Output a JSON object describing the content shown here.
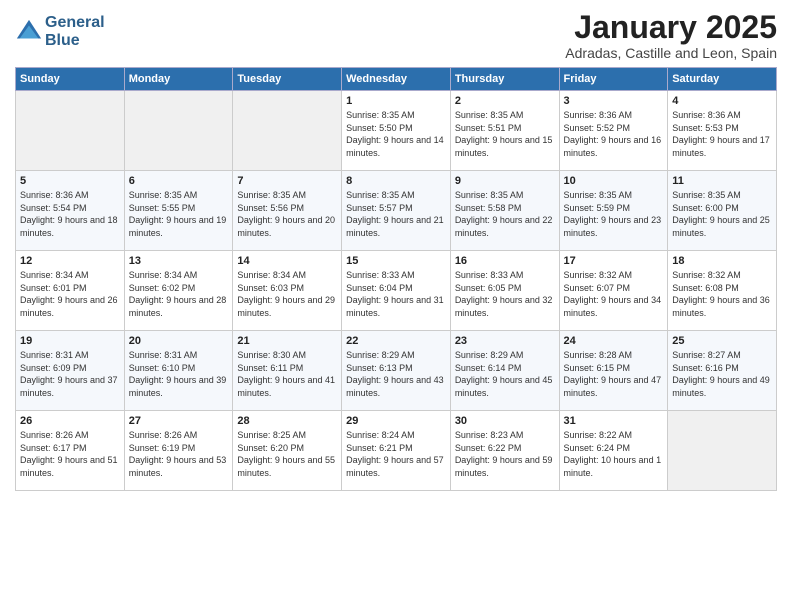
{
  "header": {
    "logo_line1": "General",
    "logo_line2": "Blue",
    "month_title": "January 2025",
    "location": "Adradas, Castille and Leon, Spain"
  },
  "weekdays": [
    "Sunday",
    "Monday",
    "Tuesday",
    "Wednesday",
    "Thursday",
    "Friday",
    "Saturday"
  ],
  "weeks": [
    [
      {
        "day": "",
        "sunrise": "",
        "sunset": "",
        "daylight": ""
      },
      {
        "day": "",
        "sunrise": "",
        "sunset": "",
        "daylight": ""
      },
      {
        "day": "",
        "sunrise": "",
        "sunset": "",
        "daylight": ""
      },
      {
        "day": "1",
        "sunrise": "Sunrise: 8:35 AM",
        "sunset": "Sunset: 5:50 PM",
        "daylight": "Daylight: 9 hours and 14 minutes."
      },
      {
        "day": "2",
        "sunrise": "Sunrise: 8:35 AM",
        "sunset": "Sunset: 5:51 PM",
        "daylight": "Daylight: 9 hours and 15 minutes."
      },
      {
        "day": "3",
        "sunrise": "Sunrise: 8:36 AM",
        "sunset": "Sunset: 5:52 PM",
        "daylight": "Daylight: 9 hours and 16 minutes."
      },
      {
        "day": "4",
        "sunrise": "Sunrise: 8:36 AM",
        "sunset": "Sunset: 5:53 PM",
        "daylight": "Daylight: 9 hours and 17 minutes."
      }
    ],
    [
      {
        "day": "5",
        "sunrise": "Sunrise: 8:36 AM",
        "sunset": "Sunset: 5:54 PM",
        "daylight": "Daylight: 9 hours and 18 minutes."
      },
      {
        "day": "6",
        "sunrise": "Sunrise: 8:35 AM",
        "sunset": "Sunset: 5:55 PM",
        "daylight": "Daylight: 9 hours and 19 minutes."
      },
      {
        "day": "7",
        "sunrise": "Sunrise: 8:35 AM",
        "sunset": "Sunset: 5:56 PM",
        "daylight": "Daylight: 9 hours and 20 minutes."
      },
      {
        "day": "8",
        "sunrise": "Sunrise: 8:35 AM",
        "sunset": "Sunset: 5:57 PM",
        "daylight": "Daylight: 9 hours and 21 minutes."
      },
      {
        "day": "9",
        "sunrise": "Sunrise: 8:35 AM",
        "sunset": "Sunset: 5:58 PM",
        "daylight": "Daylight: 9 hours and 22 minutes."
      },
      {
        "day": "10",
        "sunrise": "Sunrise: 8:35 AM",
        "sunset": "Sunset: 5:59 PM",
        "daylight": "Daylight: 9 hours and 23 minutes."
      },
      {
        "day": "11",
        "sunrise": "Sunrise: 8:35 AM",
        "sunset": "Sunset: 6:00 PM",
        "daylight": "Daylight: 9 hours and 25 minutes."
      }
    ],
    [
      {
        "day": "12",
        "sunrise": "Sunrise: 8:34 AM",
        "sunset": "Sunset: 6:01 PM",
        "daylight": "Daylight: 9 hours and 26 minutes."
      },
      {
        "day": "13",
        "sunrise": "Sunrise: 8:34 AM",
        "sunset": "Sunset: 6:02 PM",
        "daylight": "Daylight: 9 hours and 28 minutes."
      },
      {
        "day": "14",
        "sunrise": "Sunrise: 8:34 AM",
        "sunset": "Sunset: 6:03 PM",
        "daylight": "Daylight: 9 hours and 29 minutes."
      },
      {
        "day": "15",
        "sunrise": "Sunrise: 8:33 AM",
        "sunset": "Sunset: 6:04 PM",
        "daylight": "Daylight: 9 hours and 31 minutes."
      },
      {
        "day": "16",
        "sunrise": "Sunrise: 8:33 AM",
        "sunset": "Sunset: 6:05 PM",
        "daylight": "Daylight: 9 hours and 32 minutes."
      },
      {
        "day": "17",
        "sunrise": "Sunrise: 8:32 AM",
        "sunset": "Sunset: 6:07 PM",
        "daylight": "Daylight: 9 hours and 34 minutes."
      },
      {
        "day": "18",
        "sunrise": "Sunrise: 8:32 AM",
        "sunset": "Sunset: 6:08 PM",
        "daylight": "Daylight: 9 hours and 36 minutes."
      }
    ],
    [
      {
        "day": "19",
        "sunrise": "Sunrise: 8:31 AM",
        "sunset": "Sunset: 6:09 PM",
        "daylight": "Daylight: 9 hours and 37 minutes."
      },
      {
        "day": "20",
        "sunrise": "Sunrise: 8:31 AM",
        "sunset": "Sunset: 6:10 PM",
        "daylight": "Daylight: 9 hours and 39 minutes."
      },
      {
        "day": "21",
        "sunrise": "Sunrise: 8:30 AM",
        "sunset": "Sunset: 6:11 PM",
        "daylight": "Daylight: 9 hours and 41 minutes."
      },
      {
        "day": "22",
        "sunrise": "Sunrise: 8:29 AM",
        "sunset": "Sunset: 6:13 PM",
        "daylight": "Daylight: 9 hours and 43 minutes."
      },
      {
        "day": "23",
        "sunrise": "Sunrise: 8:29 AM",
        "sunset": "Sunset: 6:14 PM",
        "daylight": "Daylight: 9 hours and 45 minutes."
      },
      {
        "day": "24",
        "sunrise": "Sunrise: 8:28 AM",
        "sunset": "Sunset: 6:15 PM",
        "daylight": "Daylight: 9 hours and 47 minutes."
      },
      {
        "day": "25",
        "sunrise": "Sunrise: 8:27 AM",
        "sunset": "Sunset: 6:16 PM",
        "daylight": "Daylight: 9 hours and 49 minutes."
      }
    ],
    [
      {
        "day": "26",
        "sunrise": "Sunrise: 8:26 AM",
        "sunset": "Sunset: 6:17 PM",
        "daylight": "Daylight: 9 hours and 51 minutes."
      },
      {
        "day": "27",
        "sunrise": "Sunrise: 8:26 AM",
        "sunset": "Sunset: 6:19 PM",
        "daylight": "Daylight: 9 hours and 53 minutes."
      },
      {
        "day": "28",
        "sunrise": "Sunrise: 8:25 AM",
        "sunset": "Sunset: 6:20 PM",
        "daylight": "Daylight: 9 hours and 55 minutes."
      },
      {
        "day": "29",
        "sunrise": "Sunrise: 8:24 AM",
        "sunset": "Sunset: 6:21 PM",
        "daylight": "Daylight: 9 hours and 57 minutes."
      },
      {
        "day": "30",
        "sunrise": "Sunrise: 8:23 AM",
        "sunset": "Sunset: 6:22 PM",
        "daylight": "Daylight: 9 hours and 59 minutes."
      },
      {
        "day": "31",
        "sunrise": "Sunrise: 8:22 AM",
        "sunset": "Sunset: 6:24 PM",
        "daylight": "Daylight: 10 hours and 1 minute."
      },
      {
        "day": "",
        "sunrise": "",
        "sunset": "",
        "daylight": ""
      }
    ]
  ]
}
